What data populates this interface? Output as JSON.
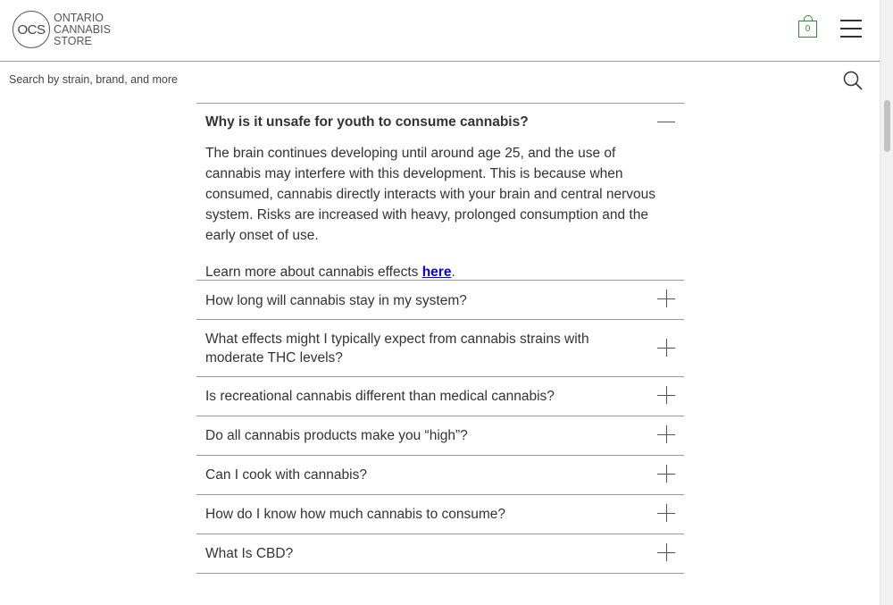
{
  "header": {
    "logo_abbr": "OCS",
    "logo_lines": [
      "ONTARIO",
      "CANNABIS",
      "STORE"
    ],
    "cart_count": "0",
    "brand_color": "#2e8b2e"
  },
  "search": {
    "placeholder": "Search by strain, brand, and more"
  },
  "faq": {
    "open_item": {
      "question": "Why is it unsafe for youth to consume cannabis?",
      "answer": "The brain continues developing until around age 25, and the use of cannabis may interfere with this development.  This is because when consumed, cannabis directly interacts with your brain and central nervous system.  Risks are increased with heavy, prolonged consumption and the early onset of use.",
      "more_prefix": "Learn more about cannabis effects ",
      "more_link": "here",
      "more_suffix": "."
    },
    "items": [
      {
        "question": "How long will cannabis stay in my system?"
      },
      {
        "question": "What effects might I typically expect from cannabis strains with moderate THC levels?"
      },
      {
        "question": "Is recreational cannabis different than medical cannabis?"
      },
      {
        "question": "Do all cannabis products make you “high”?"
      },
      {
        "question": "Can I cook with cannabis?"
      },
      {
        "question": "How do I know how much cannabis to consume?"
      },
      {
        "question": "What Is CBD?"
      }
    ]
  }
}
